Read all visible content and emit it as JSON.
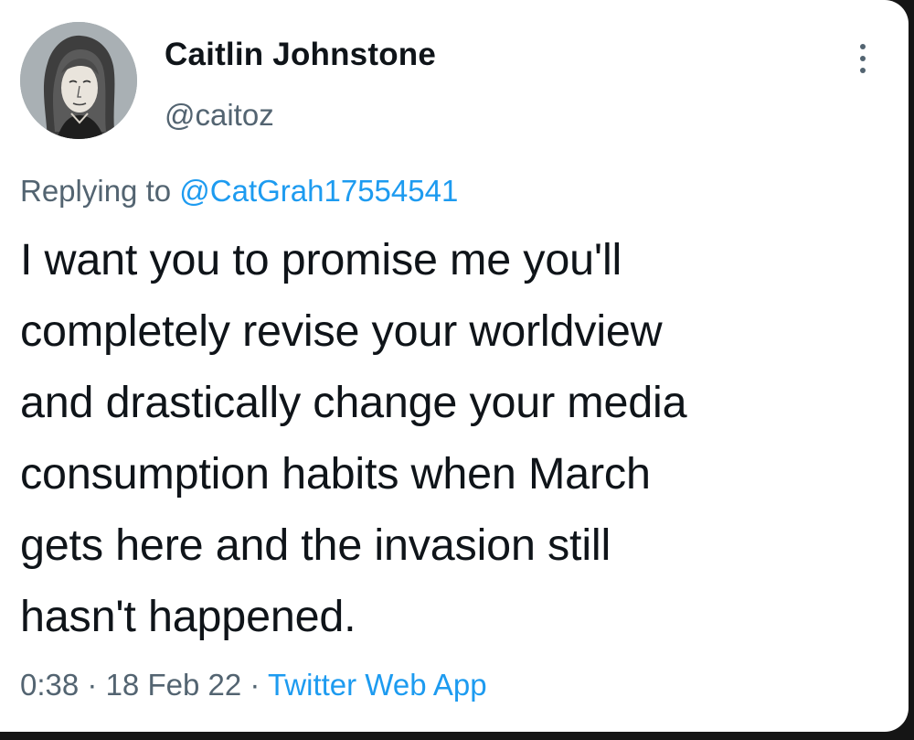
{
  "author": {
    "display_name": "Caitlin Johnstone",
    "handle": "@caitoz",
    "avatar_icon": "portrait-avatar"
  },
  "reply": {
    "prefix": "Replying to",
    "mention": "@CatGrah17554541"
  },
  "tweet": {
    "lines": [
      "I want you to promise me you'll",
      "completely revise your worldview",
      "and drastically change your media",
      "consumption habits when March",
      "gets here and the invasion still",
      "hasn't happened."
    ]
  },
  "meta": {
    "time": "0:38",
    "separator": "·",
    "date": "18 Feb 22",
    "source": "Twitter Web App"
  },
  "icons": {
    "more": "vertical-ellipsis-icon"
  },
  "colors": {
    "text_primary": "#0f1419",
    "text_secondary": "#536471",
    "link": "#1d9bf0",
    "background": "#ffffff"
  }
}
